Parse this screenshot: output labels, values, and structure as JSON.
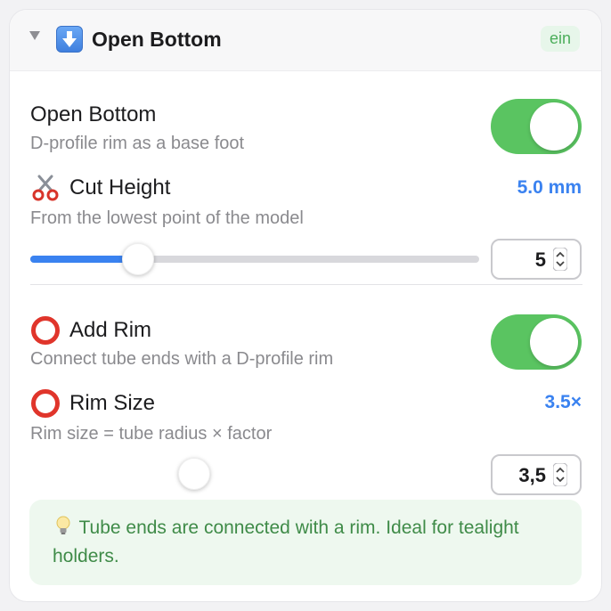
{
  "header": {
    "title": "Open Bottom",
    "badge": "ein",
    "icon": "down-arrow-emoji"
  },
  "open_bottom": {
    "label": "Open Bottom",
    "description": "D-profile rim as a base foot",
    "enabled": true
  },
  "cut_height": {
    "label": "Cut Height",
    "description": "From the lowest point of the model",
    "value_display": "5.0 mm",
    "input_value": "5",
    "slider_fraction": 0.24,
    "icon": "scissors-icon"
  },
  "add_rim": {
    "label": "Add Rim",
    "description": "Connect tube ends with a D-profile rim",
    "enabled": true,
    "icon": "red-circle-icon"
  },
  "rim_size": {
    "label": "Rim Size",
    "description": "Rim size = tube radius × factor",
    "value_display": "3.5×",
    "input_value": "3,5",
    "icon": "red-circle-icon"
  },
  "tip": {
    "text": "Tube ends are connected with a rim. Ideal for tealight holders.",
    "icon": "light-bulb-icon"
  },
  "colors": {
    "accent": "#3a82f0",
    "toggle_on": "#5ac461",
    "badge_text": "#4cae5b",
    "tip_bg": "#eef8ef",
    "tip_text": "#3f8b48"
  }
}
